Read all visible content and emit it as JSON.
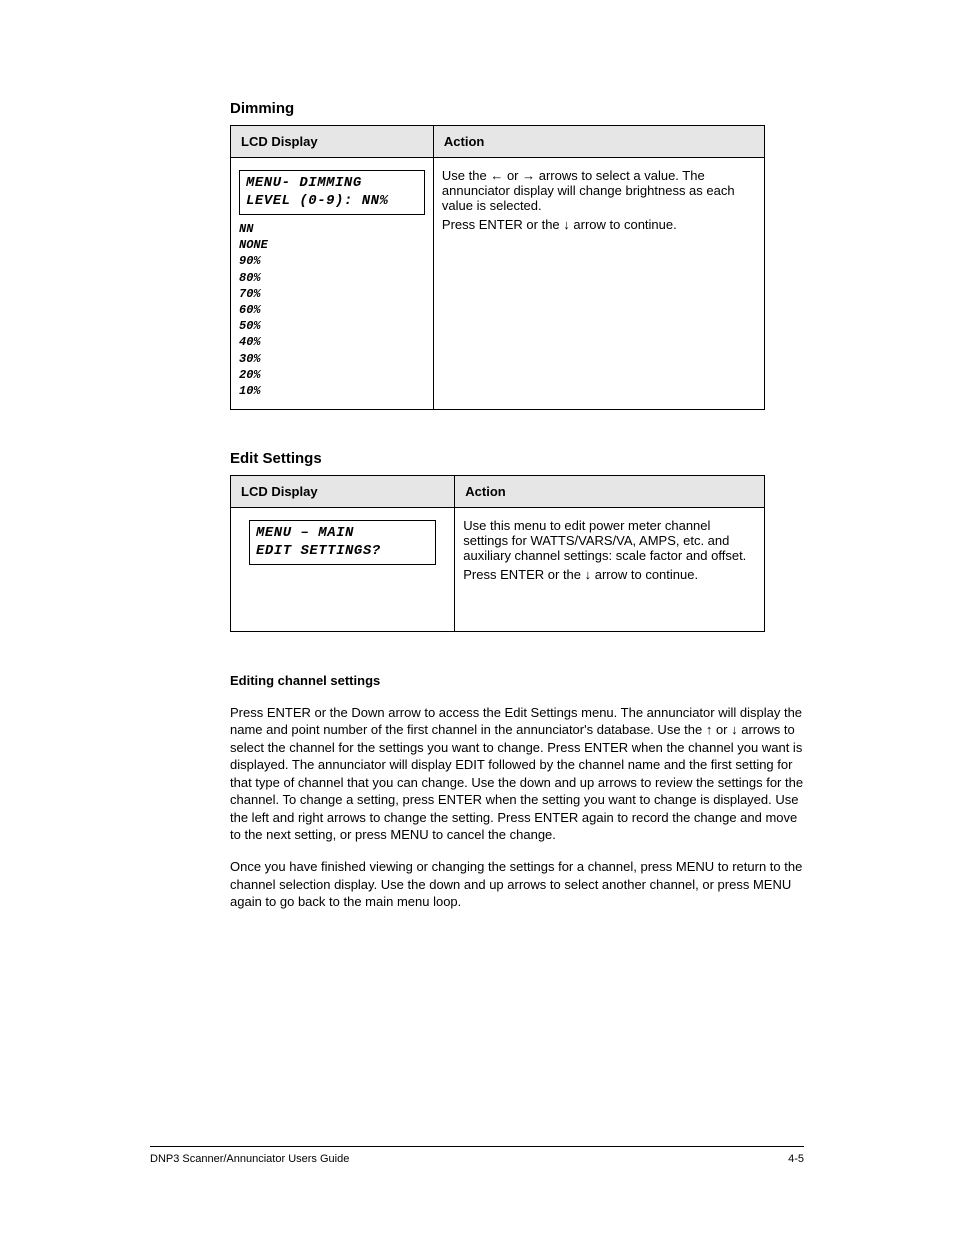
{
  "section1": {
    "title": "Dimming",
    "header_lcd": "LCD Display",
    "header_action": "Action",
    "lcd_line1": "MENU- DIMMING",
    "lcd_line2": "LEVEL (0-9):  NN%",
    "nn_heading": "NN",
    "dim_values": [
      "NONE",
      "90%",
      "80%",
      "70%",
      "60%",
      "50%",
      "40%",
      "30%",
      "20%",
      "10%"
    ],
    "action_p1_a": "Use the ",
    "action_p1_b": " or ",
    "action_p1_c": " arrows to select a value. The annunciator display will change brightness as each value is selected.",
    "arrow_left": "←",
    "arrow_right": "→",
    "action_p2_a": "Press ENTER or the ",
    "arrow_down": "↓",
    "action_p2_b": " arrow to continue."
  },
  "section2": {
    "title": "Edit Settings",
    "header_lcd": "LCD Display",
    "header_action": "Action",
    "lcd_line1": "MENU – MAIN",
    "lcd_line2": "EDIT SETTINGS?",
    "action_p1": "Use this menu to edit power meter channel settings for WATTS/VARS/VA, AMPS, etc. and auxiliary channel settings: scale factor and offset.",
    "action_p2_a": "Press ENTER or the ",
    "arrow_down": "↓",
    "action_p2_b": " arrow to continue."
  },
  "body": {
    "heading": "Editing channel settings",
    "p1_a": "Press ENTER or the Down arrow to access the Edit Settings menu. The annunciator will display the name and point number of the first channel in the annunciator's database. Use the ",
    "arrow_up": "↑",
    "p1_b": " or ",
    "arrow_down": "↓",
    "p1_c": " arrows to select the channel for the settings you want to change. Press ENTER when the channel you want is displayed. The annunciator will display EDIT followed by the channel name and the first setting for that type of channel that you can change. Use the down and up arrows to review the settings for the channel. To change a setting, press ENTER when the setting you want to change is displayed. Use the left and right arrows to change the setting. Press ENTER again to record the change and move to the next setting, or press MENU to cancel the change.",
    "p2": "Once you have finished viewing or changing the settings for a channel, press MENU to return to the channel selection display. Use the down and up arrows to select another channel, or press MENU again to go back to the main menu loop."
  },
  "footer": {
    "left": "DNP3 Scanner/Annunciator Users Guide",
    "right": "4-5"
  }
}
